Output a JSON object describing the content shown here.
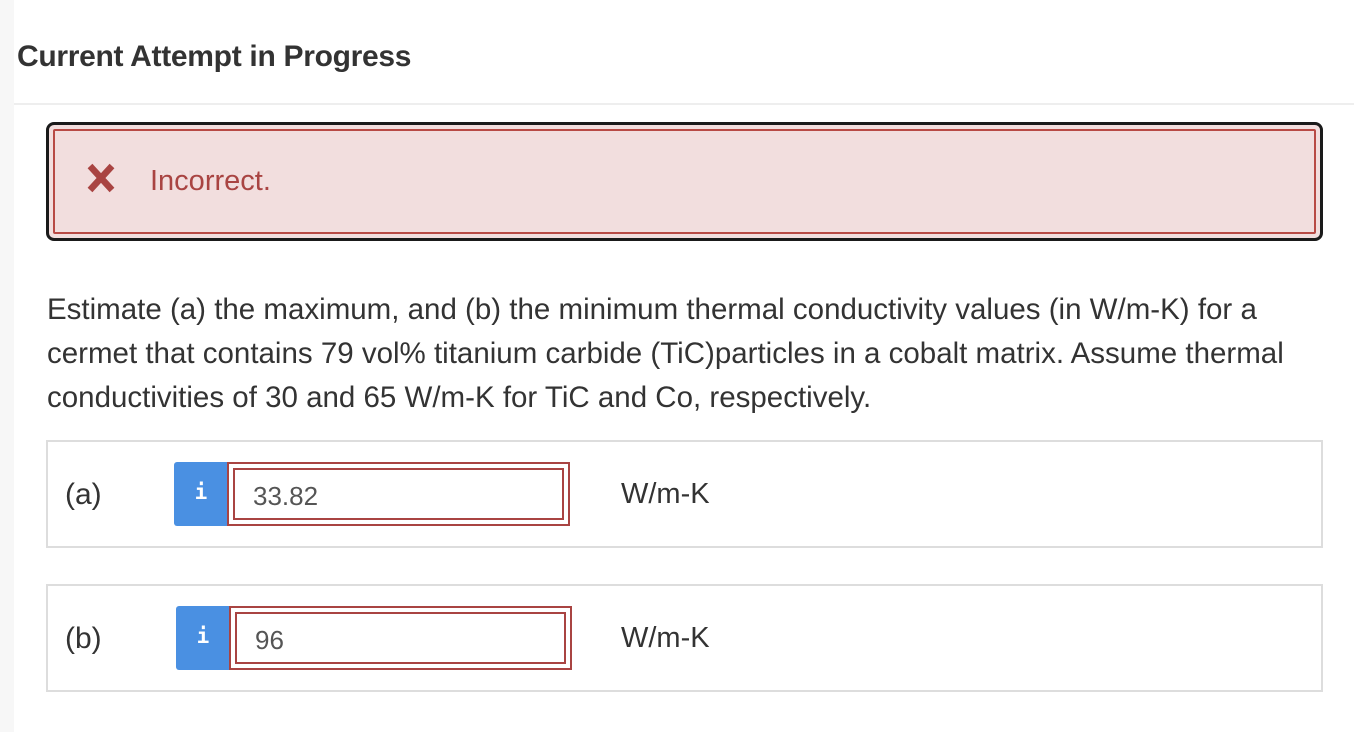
{
  "header": {
    "title": "Current Attempt in Progress"
  },
  "feedback": {
    "icon": "close-icon",
    "status_text": "Incorrect.",
    "colors": {
      "text": "#a94442",
      "background": "#f2dede"
    }
  },
  "question": {
    "text": "Estimate (a) the maximum, and (b) the minimum thermal conductivity values (in W/m-K) for a cermet that contains 79 vol% titanium carbide (TiC)particles in a cobalt matrix. Assume thermal conductivities of 30 and 65 W/m-K for TiC and Co, respectively."
  },
  "answers": [
    {
      "label": "(a)",
      "info_icon": "info-icon",
      "info_label": "i",
      "value": "33.82",
      "unit": "W/m-K"
    },
    {
      "label": "(b)",
      "info_icon": "info-icon",
      "info_label": "i",
      "value": "96",
      "unit": "W/m-K"
    }
  ],
  "colors": {
    "info_button": "#4a90e2",
    "input_error_border": "#a94442"
  }
}
